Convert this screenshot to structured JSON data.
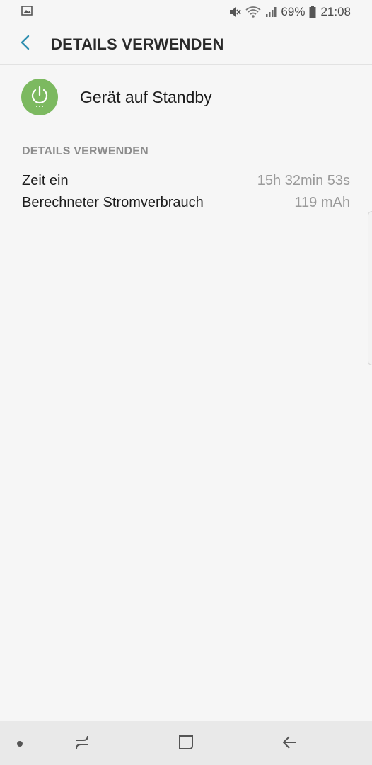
{
  "status_bar": {
    "battery_percent": "69%",
    "clock": "21:08",
    "icons": [
      "image-icon",
      "mute-icon",
      "wifi-icon",
      "signal-icon",
      "battery-icon"
    ]
  },
  "header": {
    "title": "DETAILS VERWENDEN"
  },
  "app": {
    "name": "Gerät auf Standby",
    "icon": "power-icon",
    "icon_color": "#7cb960"
  },
  "section": {
    "title": "DETAILS VERWENDEN"
  },
  "details": [
    {
      "label": "Zeit ein",
      "value": "15h 32min 53s"
    },
    {
      "label": "Berechneter Stromverbrauch",
      "value": "119 mAh"
    }
  ],
  "nav_bar": {
    "buttons": [
      "recent-apps-icon",
      "home-icon",
      "back-arrow-icon"
    ]
  },
  "colors": {
    "accent": "#2f8fb0",
    "background": "#f6f6f6",
    "nav_background": "#e9e9e9"
  }
}
